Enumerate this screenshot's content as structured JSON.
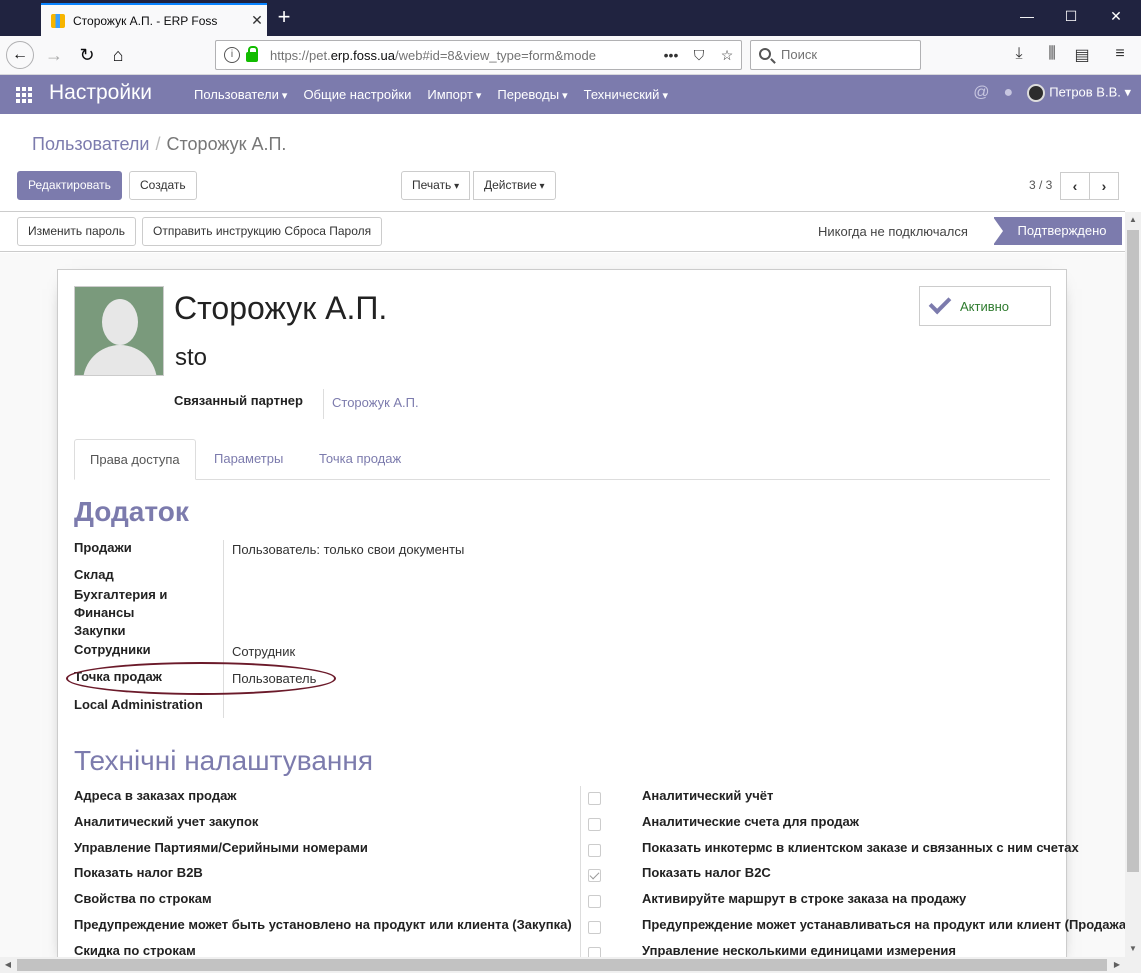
{
  "browser": {
    "tab_title": "Сторожук А.П. - ERP Foss",
    "tab_close": "✕",
    "new_tab": "+",
    "minimize": "—",
    "maximize": "☐",
    "close": "✕",
    "url_prefix": "https://pet.",
    "url_domain": "erp.foss.ua",
    "url_rest": "/web#id=8&view_type=form&mode",
    "url_more": "•••",
    "search_placeholder": "Поиск",
    "back": "←",
    "forward": "→",
    "reload": "↻",
    "home": "⌂"
  },
  "appbar": {
    "title": "Настройки",
    "menu": [
      {
        "label": "Пользователи",
        "dropdown": true
      },
      {
        "label": "Общие настройки",
        "dropdown": false
      },
      {
        "label": "Импорт",
        "dropdown": true
      },
      {
        "label": "Переводы",
        "dropdown": true
      },
      {
        "label": "Технический",
        "dropdown": true
      }
    ],
    "user_name": "Петров В.В.",
    "mention_icon": "@",
    "chat_icon": "💬"
  },
  "breadcrumb": {
    "parent": "Пользователи",
    "separator": "/",
    "current": "Сторожук А.П."
  },
  "actions": {
    "edit": "Редактировать",
    "create": "Создать",
    "print": "Печать",
    "action": "Действие",
    "pager": "3 / 3",
    "prev": "‹",
    "next": "›"
  },
  "header_buttons": {
    "change_password": "Изменить пароль",
    "send_reset": "Отправить инструкцию Сброса Пароля"
  },
  "status": {
    "never_connected": "Никогда не подключался",
    "confirmed": "Подтверждено"
  },
  "user": {
    "name": "Сторожук А.П.",
    "login": "sto",
    "active_label": "Активно",
    "partner_label": "Связанный партнер",
    "partner_value": "Сторожук А.П."
  },
  "tabs": [
    "Права доступа",
    "Параметры",
    "Точка продаж"
  ],
  "access": {
    "section_title": "Додаток",
    "rows": [
      {
        "label": "Продажи",
        "value": "Пользователь: только свои документы"
      },
      {
        "label": "Склад",
        "value": ""
      },
      {
        "label": "Бухгалтерия и Финансы",
        "value": ""
      },
      {
        "label": "Закупки",
        "value": ""
      },
      {
        "label": "Сотрудники",
        "value": "Сотрудник"
      },
      {
        "label": "Точка продаж",
        "value": "Пользователь"
      },
      {
        "label": "Local Administration",
        "value": ""
      }
    ]
  },
  "technical": {
    "section_title": "Технічні налаштування",
    "left": [
      {
        "label": "Адреса в заказах продаж",
        "checked": false
      },
      {
        "label": "Аналитический учет закупок",
        "checked": false
      },
      {
        "label": "Управление Партиями/Серийными номерами",
        "checked": false
      },
      {
        "label": "Показать налог B2B",
        "checked": true
      },
      {
        "label": "Свойства по строкам",
        "checked": false
      },
      {
        "label": "Предупреждение может быть установлено на продукт или клиента (Закупка)",
        "checked": false
      },
      {
        "label": "Скидка по строкам",
        "checked": false
      }
    ],
    "right": [
      "Аналитический учёт",
      "Аналитические счета для продаж",
      "Показать инкотермс в клиентском заказе и связанных с ним счетах",
      "Показать налог B2C",
      "Активируйте маршрут в строке заказа на продажу",
      "Предупреждение может устанавливаться на продукт или клиент (Продажа)",
      "Управление несколькими единицами измерения"
    ]
  }
}
